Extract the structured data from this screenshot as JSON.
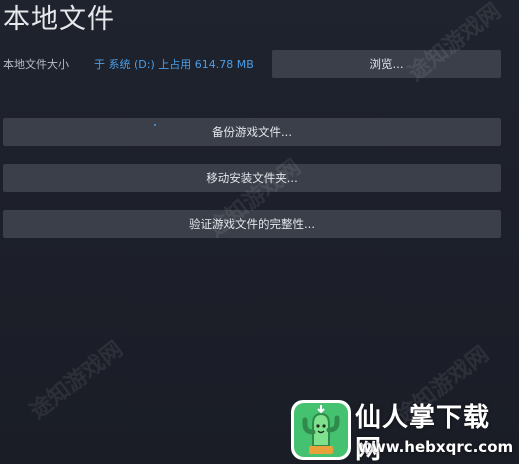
{
  "header": {
    "title": "本地文件"
  },
  "disk": {
    "label": "本地文件大小",
    "value": "于 系统 (D:) 上占用 614.78 MB",
    "browse_label": "浏览..."
  },
  "actions": {
    "backup_label": "备份游戏文件...",
    "move_label": "移动安装文件夹...",
    "verify_label": "验证游戏文件的完整性..."
  },
  "watermark": {
    "text": "途知游戏网"
  },
  "branding": {
    "name": "仙人掌下载网",
    "url": "www.hebxqrc.com"
  },
  "colors": {
    "background": "#1d212b",
    "button": "#3a3f49",
    "accent_blue": "#4a9de8",
    "logo_green": "#3db26a"
  }
}
